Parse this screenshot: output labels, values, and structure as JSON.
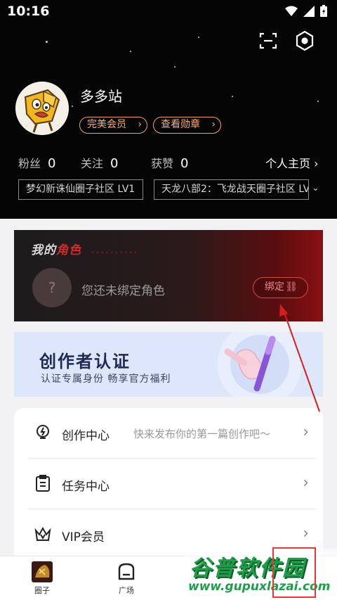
{
  "status_bar": {
    "time": "10:16"
  },
  "profile": {
    "username": "多多站",
    "member_label": "完美会员",
    "medal_label": "查看勋章",
    "stats": [
      {
        "label": "粉丝",
        "value": "0"
      },
      {
        "label": "关注",
        "value": "0"
      },
      {
        "label": "获赞",
        "value": "0"
      }
    ],
    "homepage_label": "个人主页",
    "circle_tags": [
      "梦幻新诛仙圈子社区 LV1",
      "天龙八部2：飞龙战天圈子社区 LV"
    ]
  },
  "role_card": {
    "title_prefix": "我的",
    "title_highlight": "角色",
    "question_mark": "?",
    "empty_text": "您还未绑定角色",
    "bind_label": "绑定"
  },
  "creator_banner": {
    "title": "创作者认证",
    "subtitle": "认证专属身份  畅享官方福利"
  },
  "menu": [
    {
      "label": "创作中心",
      "hint": "快来发布你的第一篇创作吧～",
      "icon": "lightbulb-icon"
    },
    {
      "label": "任务中心",
      "hint": "",
      "icon": "clipboard-icon"
    },
    {
      "label": "VIP会员",
      "hint": "",
      "icon": "vip-crown-icon"
    }
  ],
  "bottom_nav": [
    {
      "label": "圈子",
      "icon": "game-avatar-icon"
    },
    {
      "label": "广场",
      "icon": "plaza-icon"
    }
  ],
  "watermark": {
    "title": "谷普软件园",
    "url": "www.gupuxlazai.com"
  },
  "colors": {
    "accent_orange": "#f2a36a",
    "bind_red": "#d24a4a",
    "annotation_red": "#e33"
  }
}
